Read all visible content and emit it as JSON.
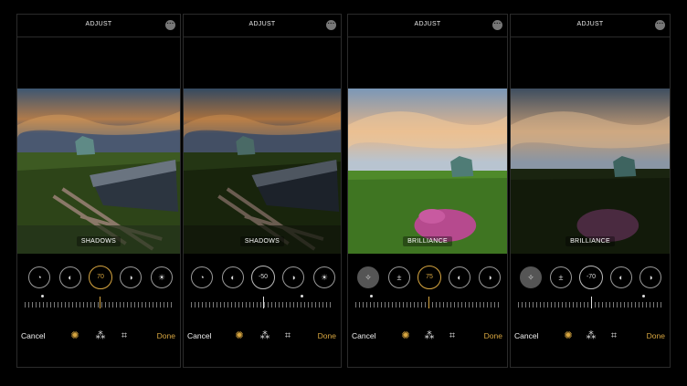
{
  "colors": {
    "accent": "#d8a640",
    "panel_border": "#2b2b2b"
  },
  "panels": [
    {
      "title": "ADJUST",
      "photo_label": "SHADOWS",
      "selected_value": "70",
      "tools": [
        "exposure-icon",
        "brilliance-icon",
        "shadows-slider",
        "contrast-icon",
        "brightness-icon"
      ],
      "cancel": "Cancel",
      "done": "Done"
    },
    {
      "title": "ADJUST",
      "photo_label": "SHADOWS",
      "selected_value": "-50",
      "tools": [
        "exposure-icon",
        "brilliance-icon",
        "shadows-slider",
        "contrast-icon",
        "brightness-icon"
      ],
      "cancel": "Cancel",
      "done": "Done"
    },
    {
      "title": "ADJUST",
      "photo_label": "BRILLIANCE",
      "selected_value": "75",
      "tools": [
        "auto-wand-icon",
        "exposure-icon",
        "brilliance-slider",
        "highlights-icon",
        "contrast-icon"
      ],
      "cancel": "Cancel",
      "done": "Done"
    },
    {
      "title": "ADJUST",
      "photo_label": "BRILLIANCE",
      "selected_value": "-70",
      "tools": [
        "auto-wand-icon",
        "exposure-icon",
        "brilliance-slider",
        "highlights-icon",
        "contrast-icon"
      ],
      "cancel": "Cancel",
      "done": "Done"
    }
  ],
  "icons": {
    "more": "ellipsis-icon",
    "adjust": "adjust-dial-icon",
    "filters": "filters-icon",
    "crop": "crop-icon"
  }
}
